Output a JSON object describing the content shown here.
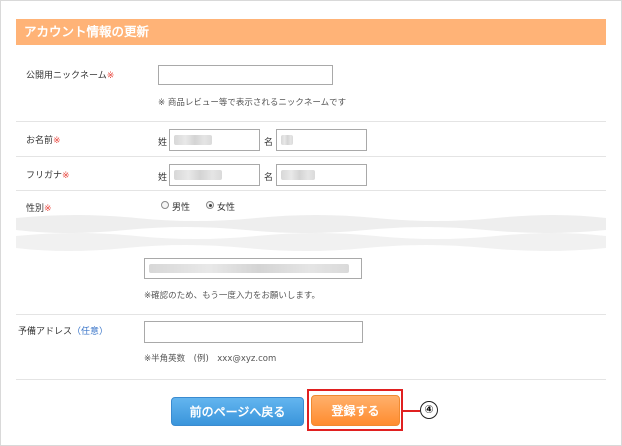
{
  "header": {
    "title": "アカウント情報の更新"
  },
  "nickname": {
    "label": "公開用ニックネーム",
    "required_mark": "※",
    "value": "",
    "hint": "※ 商品レビュー等で表示されるニックネームです"
  },
  "name": {
    "label": "お名前",
    "required_mark": "※",
    "last_label": "姓",
    "first_label": "名"
  },
  "furigana": {
    "label": "フリガナ",
    "required_mark": "※",
    "last_label": "姓",
    "first_label": "名"
  },
  "gender": {
    "label": "性別",
    "required_mark": "※",
    "options": [
      "男性",
      "女性"
    ],
    "selected": "女性"
  },
  "email_confirm": {
    "hint": "※確認のため、もう一度入力をお願いします。"
  },
  "backup_email": {
    "label": "予備アドレス",
    "optional_mark": "（任意）",
    "value": "",
    "hint": "※半角英数　(例)　xxx@xyz.com"
  },
  "buttons": {
    "back": "前のページへ戻る",
    "register": "登録する"
  },
  "callout": {
    "number": "④"
  },
  "colors": {
    "header": "#ffb377",
    "back_button": "#3a95db",
    "register_button": "#ff8c2f",
    "highlight": "#e02020",
    "required": "#e8453c"
  }
}
